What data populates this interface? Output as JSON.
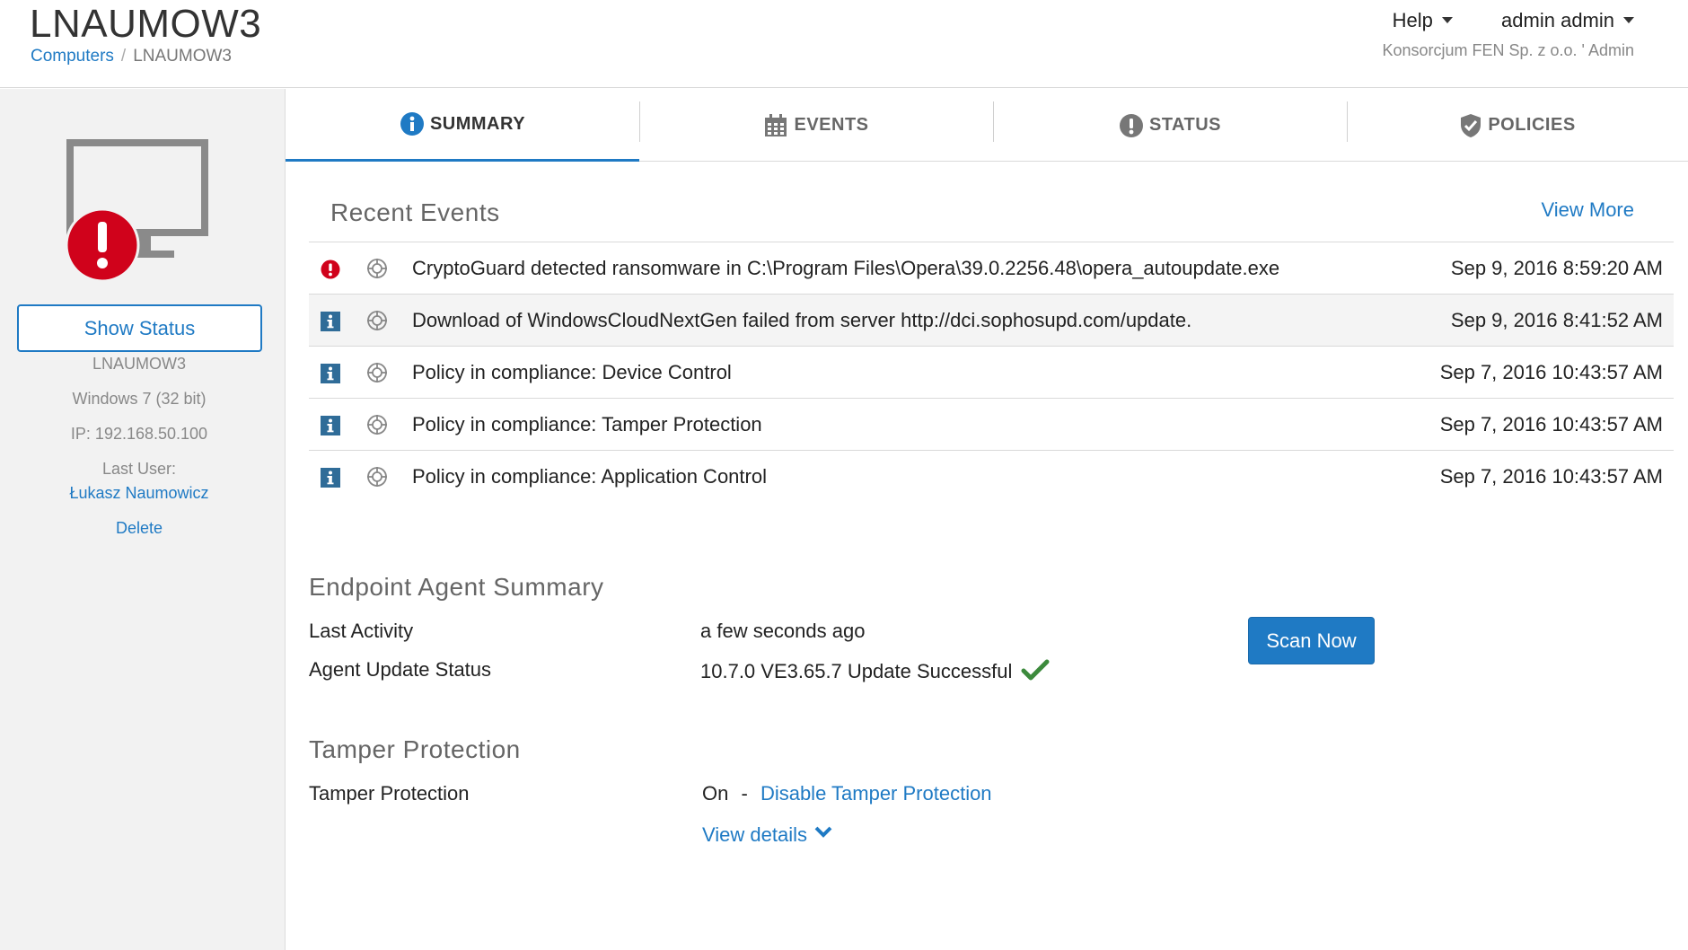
{
  "header": {
    "title": "LNAUMOW3",
    "breadcrumb": {
      "parent": "Computers",
      "separator": "/",
      "current": "LNAUMOW3"
    },
    "help_label": "Help",
    "user_label": "admin admin",
    "org_line": "Konsorcjum FEN Sp. z o.o. ' Admin"
  },
  "sidebar": {
    "show_status_label": "Show Status",
    "computer_name": "LNAUMOW3",
    "os": "Windows 7 (32 bit)",
    "ip": "IP: 192.168.50.100",
    "last_user_label": "Last User:",
    "last_user": "Łukasz Naumowicz",
    "delete_label": "Delete"
  },
  "tabs": [
    {
      "label": "SUMMARY",
      "icon": "info-icon",
      "active": true
    },
    {
      "label": "EVENTS",
      "icon": "calendar-icon",
      "active": false
    },
    {
      "label": "STATUS",
      "icon": "alert-icon",
      "active": false
    },
    {
      "label": "POLICIES",
      "icon": "shield-icon",
      "active": false
    }
  ],
  "recent_events": {
    "title": "Recent Events",
    "view_more_label": "View More",
    "rows": [
      {
        "severity": "critical",
        "text": "CryptoGuard detected ransomware in C:\\Program Files\\Opera\\39.0.2256.48\\opera_autoupdate.exe",
        "time": "Sep 9, 2016 8:59:20 AM"
      },
      {
        "severity": "info",
        "text": "Download of WindowsCloudNextGen failed from server http://dci.sophosupd.com/update.",
        "time": "Sep 9, 2016 8:41:52 AM"
      },
      {
        "severity": "info",
        "text": "Policy in compliance: Device Control",
        "time": "Sep 7, 2016 10:43:57 AM"
      },
      {
        "severity": "info",
        "text": "Policy in compliance: Tamper Protection",
        "time": "Sep 7, 2016 10:43:57 AM"
      },
      {
        "severity": "info",
        "text": "Policy in compliance: Application Control",
        "time": "Sep 7, 2016 10:43:57 AM"
      }
    ]
  },
  "agent_summary": {
    "title": "Endpoint Agent Summary",
    "last_activity_label": "Last Activity",
    "last_activity_value": "a few seconds ago",
    "update_status_label": "Agent Update Status",
    "update_status_value": "10.7.0 VE3.65.7 Update Successful",
    "scan_now_label": "Scan Now"
  },
  "tamper": {
    "title": "Tamper Protection",
    "label": "Tamper Protection",
    "state": "On",
    "dash": "-",
    "disable_label": "Disable Tamper Protection",
    "view_details_label": "View details"
  },
  "colors": {
    "accent": "#1f7ac4",
    "critical": "#d0021b",
    "success": "#3c8a3c",
    "info_badge": "#2f6c98"
  }
}
